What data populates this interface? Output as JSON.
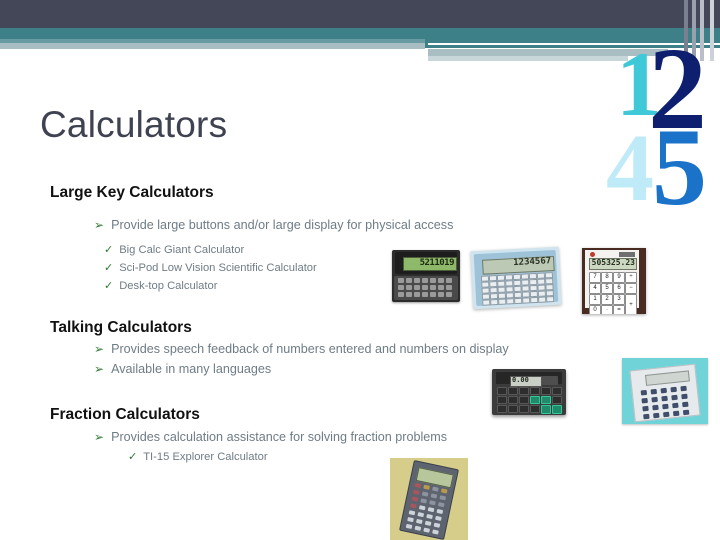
{
  "slide": {
    "title": "Calculators",
    "decor_numbers": [
      "1",
      "2",
      "4",
      "5"
    ],
    "colors": {
      "header_navy": "#434757",
      "header_teal": "#3d8088",
      "header_gray": "#a8bec2",
      "title_text": "#3f4250",
      "body_text": "#6f7c85",
      "heading_text": "#111111",
      "bullet_green": "#2f7a34",
      "num_1": "#3ec8d8",
      "num_2": "#0d1f6e",
      "num_4": "#bfeaf7",
      "num_5": "#1b72c9"
    }
  },
  "bullets": {
    "arrow_glyph": "➢",
    "check_glyph": "✓"
  },
  "sections": [
    {
      "heading": "Large Key Calculators",
      "level1": [
        "Provide large buttons and/or large display for physical access"
      ],
      "level2": [
        "Big Calc Giant Calculator",
        "Sci-Pod Low Vision Scientific Calculator",
        "Desk-top Calculator"
      ]
    },
    {
      "heading": "Talking Calculators",
      "level1": [
        "Provides speech feedback of numbers entered and numbers on display",
        "Available in many languages"
      ],
      "level2": []
    },
    {
      "heading": "Fraction Calculators",
      "level1": [
        "Provides calculation assistance for solving fraction problems"
      ],
      "level2": [
        "TI-15 Explorer Calculator"
      ]
    }
  ],
  "images": [
    {
      "name": "folding-pocket-calculator",
      "display_value": "5211019"
    },
    {
      "name": "blue-scientific-calculator",
      "display_value": "1234567"
    },
    {
      "name": "white-large-key-desktop-calculator",
      "display_value": "505325.23"
    },
    {
      "name": "talking-calculator",
      "display_value": "0.00"
    },
    {
      "name": "silver-calculator-on-turquoise",
      "display_value": ""
    },
    {
      "name": "ti-15-explorer-calculator",
      "display_value": ""
    }
  ]
}
